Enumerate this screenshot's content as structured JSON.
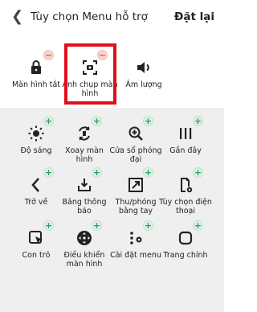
{
  "header": {
    "back_icon": "back-arrow-icon",
    "title": "Tùy chọn Menu hỗ trợ",
    "reset_label": "Đặt lại"
  },
  "selected": [
    {
      "label": "Màn hình tắt",
      "icon": "lock-icon"
    },
    {
      "label": "Ảnh chụp màn hình",
      "icon": "screenshot-icon"
    },
    {
      "label": "Âm lượng",
      "icon": "volume-icon"
    }
  ],
  "available": [
    {
      "label": "Độ sáng",
      "icon": "brightness-icon"
    },
    {
      "label": "Xoay màn hình",
      "icon": "rotate-icon"
    },
    {
      "label": "Cửa sổ phóng đại",
      "icon": "zoom-icon"
    },
    {
      "label": "Gần đây",
      "icon": "recent-apps-icon"
    },
    {
      "label": "Trở về",
      "icon": "back-icon"
    },
    {
      "label": "Bảng thông báo",
      "icon": "notification-panel-icon"
    },
    {
      "label": "Thu/phóng bằng tay",
      "icon": "manual-zoom-icon"
    },
    {
      "label": "Tùy chọn điện thoại",
      "icon": "phone-settings-icon"
    },
    {
      "label": "Con trỏ",
      "icon": "pointer-icon"
    },
    {
      "label": "Điều khiển màn hình",
      "icon": "screen-control-icon"
    },
    {
      "label": "Cài đặt menu",
      "icon": "menu-settings-icon"
    },
    {
      "label": "Trang chính",
      "icon": "home-icon"
    }
  ],
  "badges": {
    "remove": "−",
    "add": "+"
  }
}
